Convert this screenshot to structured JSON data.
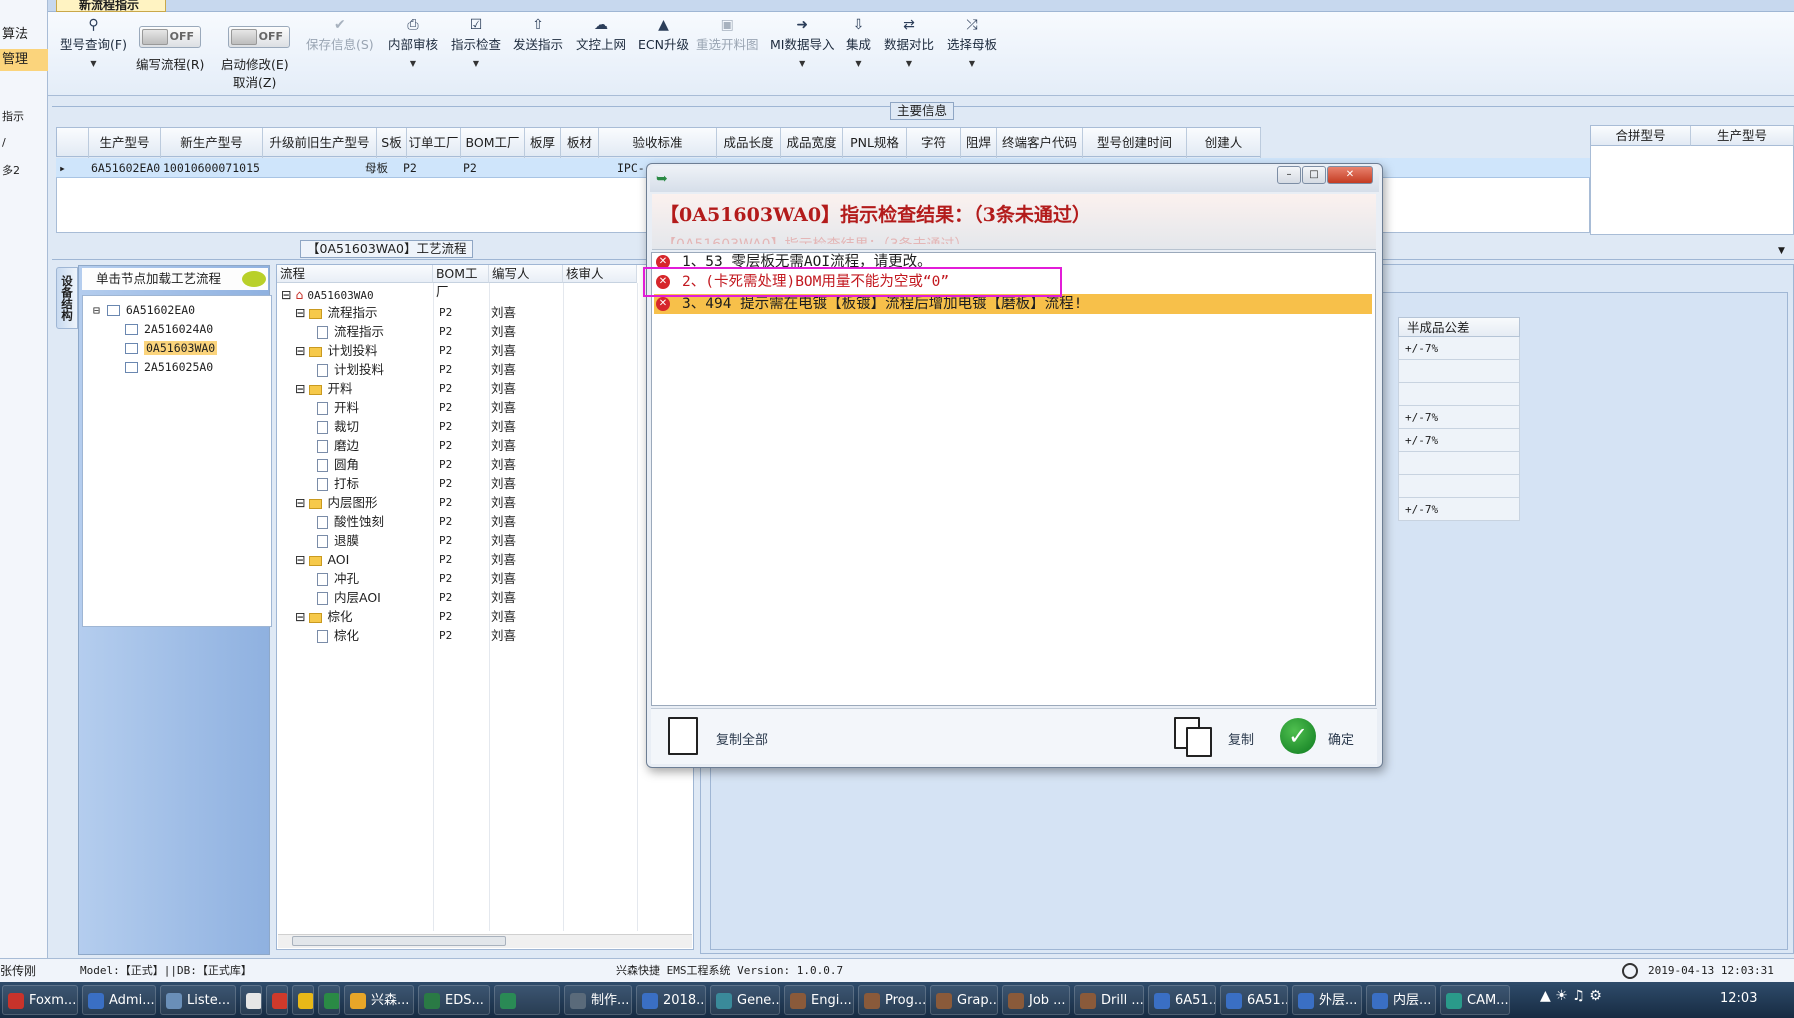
{
  "left_strip": {
    "items": [
      "算法",
      "管理",
      "指示",
      "/",
      "多2"
    ]
  },
  "tab": {
    "label": "新流程指示"
  },
  "ribbon": {
    "buttons": [
      {
        "label": "型号查询(F)",
        "icon": "search-icon",
        "dropdown": true
      },
      {
        "label": "保存信息(S)",
        "icon": "check-icon",
        "disabled": true
      },
      {
        "label": "内部审核",
        "icon": "print-icon",
        "dropdown": true
      },
      {
        "label": "指示检查",
        "icon": "checklist-icon",
        "dropdown": true
      },
      {
        "label": "发送指示",
        "icon": "upload-icon"
      },
      {
        "label": "文控上网",
        "icon": "cloud-upload-icon"
      },
      {
        "label": "ECN升级",
        "icon": "ecn-icon"
      },
      {
        "label": "重选开料图",
        "icon": "image-icon",
        "disabled": true
      },
      {
        "label": "MI数据导入",
        "icon": "import-icon",
        "dropdown": true
      },
      {
        "label": "集成",
        "icon": "download-icon",
        "dropdown": true
      },
      {
        "label": "数据对比",
        "icon": "compare-icon",
        "dropdown": true
      },
      {
        "label": "选择母板",
        "icon": "shuffle-icon",
        "dropdown": true
      }
    ],
    "toggle1": {
      "state": "OFF",
      "label": "编写流程(R)"
    },
    "toggle2": {
      "state": "OFF",
      "label1": "启动修改(E)",
      "label2": "取消(Z)"
    }
  },
  "main_info": {
    "title": "主要信息",
    "columns": [
      "生产型号",
      "新生产型号",
      "升级前旧生产型号",
      "S板",
      "订单工厂",
      "BOM工厂",
      "板厚",
      "板材",
      "验收标准",
      "成品长度",
      "成品宽度",
      "PNL规格",
      "字符",
      "阻焊",
      "终端客户代码",
      "型号创建时间",
      "创建人"
    ],
    "row": {
      "model": "6A51602EA0",
      "new_model": "10010600071015",
      "s_board": "母板",
      "order_factory": "P2",
      "bom_factory": "P2",
      "standard": "IPC-"
    },
    "right_columns": [
      "合拼型号",
      "生产型号"
    ]
  },
  "process": {
    "title": "【0A51603WA0】工艺流程",
    "side_tab": "设备结构",
    "left_head": "单击节点加载工艺流程",
    "tree": [
      {
        "label": "6A51602EA0",
        "level": 0,
        "selected": false
      },
      {
        "label": "2A516024A0",
        "level": 1,
        "selected": false
      },
      {
        "label": "0A51603WA0",
        "level": 1,
        "selected": true
      },
      {
        "label": "2A516025A0",
        "level": 1,
        "selected": false
      }
    ],
    "flow_headers": [
      "流程",
      "BOM工厂",
      "编写人",
      "核审人"
    ],
    "flow_root": "0A51603WA0",
    "flow_rows": [
      {
        "name": "流程指示",
        "type": "folder",
        "bom": "P2",
        "author": "刘喜"
      },
      {
        "name": "流程指示",
        "type": "item",
        "bom": "P2",
        "author": "刘喜"
      },
      {
        "name": "计划投料",
        "type": "folder",
        "bom": "P2",
        "author": "刘喜"
      },
      {
        "name": "计划投料",
        "type": "item",
        "bom": "P2",
        "author": "刘喜"
      },
      {
        "name": "开料",
        "type": "folder",
        "bom": "P2",
        "author": "刘喜"
      },
      {
        "name": "开料",
        "type": "item",
        "bom": "P2",
        "author": "刘喜"
      },
      {
        "name": "裁切",
        "type": "item",
        "bom": "P2",
        "author": "刘喜"
      },
      {
        "name": "磨边",
        "type": "item",
        "bom": "P2",
        "author": "刘喜"
      },
      {
        "name": "圆角",
        "type": "item",
        "bom": "P2",
        "author": "刘喜"
      },
      {
        "name": "打标",
        "type": "item",
        "bom": "P2",
        "author": "刘喜"
      },
      {
        "name": "内层图形",
        "type": "folder",
        "bom": "P2",
        "author": "刘喜"
      },
      {
        "name": "酸性蚀刻",
        "type": "item",
        "bom": "P2",
        "author": "刘喜"
      },
      {
        "name": "退膜",
        "type": "item",
        "bom": "P2",
        "author": "刘喜"
      },
      {
        "name": "AOI",
        "type": "folder",
        "bom": "P2",
        "author": "刘喜"
      },
      {
        "name": "冲孔",
        "type": "item",
        "bom": "P2",
        "author": "刘喜"
      },
      {
        "name": "内层AOI",
        "type": "item",
        "bom": "P2",
        "author": "刘喜"
      },
      {
        "name": "棕化",
        "type": "folder",
        "bom": "P2",
        "author": "刘喜"
      },
      {
        "name": "棕化",
        "type": "item",
        "bom": "P2",
        "author": "刘喜"
      }
    ],
    "right_table_header": "半成品公差",
    "right_table_values": [
      "+/-7%",
      "",
      "",
      "+/-7%",
      "+/-7%",
      "",
      "",
      "+/-7%"
    ]
  },
  "dialog": {
    "heading": "【0A51603WA0】指示检查结果：（3条未通过）",
    "ghost_heading": "【0A51603WA0】指示检查结果：（3条未通过）",
    "messages": [
      "1、53 零层板无需AOI流程，请更改。",
      "2、(卡死需处理)BOM用量不能为空或“0”",
      "3、494 提示需在电镀【板镀】流程后增加电镀【磨板】流程!"
    ],
    "copy_all_label": "复制全部",
    "copy_label": "复制",
    "ok_label": "确定",
    "window_buttons": [
      "minimize",
      "maximize",
      "close"
    ]
  },
  "status_bar": {
    "user": "张传刚",
    "model": "Model:【正式】||DB:【正式库】",
    "system": "兴森快捷 EMS工程系统 Version: 1.0.0.7",
    "datetime": "2019-04-13 12:03:31"
  },
  "taskbar": {
    "items": [
      "Foxm...",
      "Admi...",
      "Liste...",
      "",
      "",
      "",
      "",
      "兴森...",
      "EDS...",
      "",
      "制作...",
      "2018...",
      "Gene...",
      "Engi...",
      "Prog...",
      "Grap...",
      "Job ...",
      "Drill ...",
      "6A51...",
      "6A51...",
      "外层...",
      "内层...",
      "CAM..."
    ],
    "clock": "12:03"
  },
  "colors": {
    "error_red": "#d6262b",
    "highlight_row": "#f7c04a",
    "annotation_box": "#e21cd8",
    "heading_red": "#b31b1b"
  }
}
